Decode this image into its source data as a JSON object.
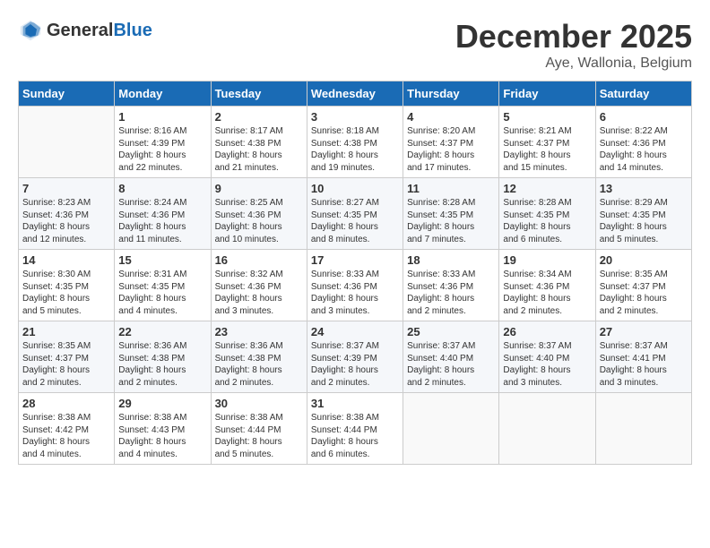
{
  "header": {
    "logo_general": "General",
    "logo_blue": "Blue",
    "month_year": "December 2025",
    "location": "Aye, Wallonia, Belgium"
  },
  "days_of_week": [
    "Sunday",
    "Monday",
    "Tuesday",
    "Wednesday",
    "Thursday",
    "Friday",
    "Saturday"
  ],
  "weeks": [
    [
      {
        "day": "",
        "info": ""
      },
      {
        "day": "1",
        "info": "Sunrise: 8:16 AM\nSunset: 4:39 PM\nDaylight: 8 hours\nand 22 minutes."
      },
      {
        "day": "2",
        "info": "Sunrise: 8:17 AM\nSunset: 4:38 PM\nDaylight: 8 hours\nand 21 minutes."
      },
      {
        "day": "3",
        "info": "Sunrise: 8:18 AM\nSunset: 4:38 PM\nDaylight: 8 hours\nand 19 minutes."
      },
      {
        "day": "4",
        "info": "Sunrise: 8:20 AM\nSunset: 4:37 PM\nDaylight: 8 hours\nand 17 minutes."
      },
      {
        "day": "5",
        "info": "Sunrise: 8:21 AM\nSunset: 4:37 PM\nDaylight: 8 hours\nand 15 minutes."
      },
      {
        "day": "6",
        "info": "Sunrise: 8:22 AM\nSunset: 4:36 PM\nDaylight: 8 hours\nand 14 minutes."
      }
    ],
    [
      {
        "day": "7",
        "info": "Sunrise: 8:23 AM\nSunset: 4:36 PM\nDaylight: 8 hours\nand 12 minutes."
      },
      {
        "day": "8",
        "info": "Sunrise: 8:24 AM\nSunset: 4:36 PM\nDaylight: 8 hours\nand 11 minutes."
      },
      {
        "day": "9",
        "info": "Sunrise: 8:25 AM\nSunset: 4:36 PM\nDaylight: 8 hours\nand 10 minutes."
      },
      {
        "day": "10",
        "info": "Sunrise: 8:27 AM\nSunset: 4:35 PM\nDaylight: 8 hours\nand 8 minutes."
      },
      {
        "day": "11",
        "info": "Sunrise: 8:28 AM\nSunset: 4:35 PM\nDaylight: 8 hours\nand 7 minutes."
      },
      {
        "day": "12",
        "info": "Sunrise: 8:28 AM\nSunset: 4:35 PM\nDaylight: 8 hours\nand 6 minutes."
      },
      {
        "day": "13",
        "info": "Sunrise: 8:29 AM\nSunset: 4:35 PM\nDaylight: 8 hours\nand 5 minutes."
      }
    ],
    [
      {
        "day": "14",
        "info": "Sunrise: 8:30 AM\nSunset: 4:35 PM\nDaylight: 8 hours\nand 5 minutes."
      },
      {
        "day": "15",
        "info": "Sunrise: 8:31 AM\nSunset: 4:35 PM\nDaylight: 8 hours\nand 4 minutes."
      },
      {
        "day": "16",
        "info": "Sunrise: 8:32 AM\nSunset: 4:36 PM\nDaylight: 8 hours\nand 3 minutes."
      },
      {
        "day": "17",
        "info": "Sunrise: 8:33 AM\nSunset: 4:36 PM\nDaylight: 8 hours\nand 3 minutes."
      },
      {
        "day": "18",
        "info": "Sunrise: 8:33 AM\nSunset: 4:36 PM\nDaylight: 8 hours\nand 2 minutes."
      },
      {
        "day": "19",
        "info": "Sunrise: 8:34 AM\nSunset: 4:36 PM\nDaylight: 8 hours\nand 2 minutes."
      },
      {
        "day": "20",
        "info": "Sunrise: 8:35 AM\nSunset: 4:37 PM\nDaylight: 8 hours\nand 2 minutes."
      }
    ],
    [
      {
        "day": "21",
        "info": "Sunrise: 8:35 AM\nSunset: 4:37 PM\nDaylight: 8 hours\nand 2 minutes."
      },
      {
        "day": "22",
        "info": "Sunrise: 8:36 AM\nSunset: 4:38 PM\nDaylight: 8 hours\nand 2 minutes."
      },
      {
        "day": "23",
        "info": "Sunrise: 8:36 AM\nSunset: 4:38 PM\nDaylight: 8 hours\nand 2 minutes."
      },
      {
        "day": "24",
        "info": "Sunrise: 8:37 AM\nSunset: 4:39 PM\nDaylight: 8 hours\nand 2 minutes."
      },
      {
        "day": "25",
        "info": "Sunrise: 8:37 AM\nSunset: 4:40 PM\nDaylight: 8 hours\nand 2 minutes."
      },
      {
        "day": "26",
        "info": "Sunrise: 8:37 AM\nSunset: 4:40 PM\nDaylight: 8 hours\nand 3 minutes."
      },
      {
        "day": "27",
        "info": "Sunrise: 8:37 AM\nSunset: 4:41 PM\nDaylight: 8 hours\nand 3 minutes."
      }
    ],
    [
      {
        "day": "28",
        "info": "Sunrise: 8:38 AM\nSunset: 4:42 PM\nDaylight: 8 hours\nand 4 minutes."
      },
      {
        "day": "29",
        "info": "Sunrise: 8:38 AM\nSunset: 4:43 PM\nDaylight: 8 hours\nand 4 minutes."
      },
      {
        "day": "30",
        "info": "Sunrise: 8:38 AM\nSunset: 4:44 PM\nDaylight: 8 hours\nand 5 minutes."
      },
      {
        "day": "31",
        "info": "Sunrise: 8:38 AM\nSunset: 4:44 PM\nDaylight: 8 hours\nand 6 minutes."
      },
      {
        "day": "",
        "info": ""
      },
      {
        "day": "",
        "info": ""
      },
      {
        "day": "",
        "info": ""
      }
    ]
  ]
}
